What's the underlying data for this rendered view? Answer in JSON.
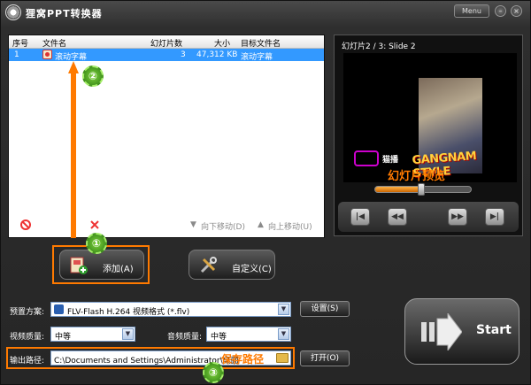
{
  "window": {
    "title": "狸窝PPT转换器",
    "menu_label": "Menu"
  },
  "table": {
    "columns": [
      "序号",
      "文件名",
      "幻灯片数",
      "大小",
      "目标文件名"
    ],
    "rows": [
      {
        "index": "1",
        "name": "滚动字幕",
        "slides": "3",
        "size": "47,312 KB",
        "target": "滚动字幕"
      }
    ]
  },
  "toolbar": {
    "remove": "移除(R)",
    "clear": "清除(L)",
    "move_down": "向下移动(D)",
    "move_up": "向上移动(U)"
  },
  "buttons": {
    "add": "添加(A)",
    "customize": "自定义(C)"
  },
  "preview": {
    "title": "幻灯片2 / 3: Slide 2",
    "slide_caption": "GANGNAM STYLE",
    "slide_logo_text": "猫播",
    "annotation": "幻灯片预览",
    "progress": 0.48
  },
  "settings": {
    "preset_label": "预置方案:",
    "preset_value": "FLV-Flash H.264 视频格式 (*.flv)",
    "settings_btn": "设置(S)",
    "video_quality_label": "视频质量:",
    "video_quality_value": "中等",
    "audio_quality_label": "音频质量:",
    "audio_quality_value": "中等",
    "output_label": "输出路径:",
    "output_value": "C:\\Documents and Settings\\Administrator\\桌面",
    "open_btn": "打开(O)",
    "save_annotation": "保存路径"
  },
  "start": {
    "label": "Start"
  },
  "badges": [
    "①",
    "②",
    "③"
  ],
  "colors": {
    "accent": "#ff7a00",
    "selection": "#3399ff",
    "badge": "#4caf20"
  }
}
